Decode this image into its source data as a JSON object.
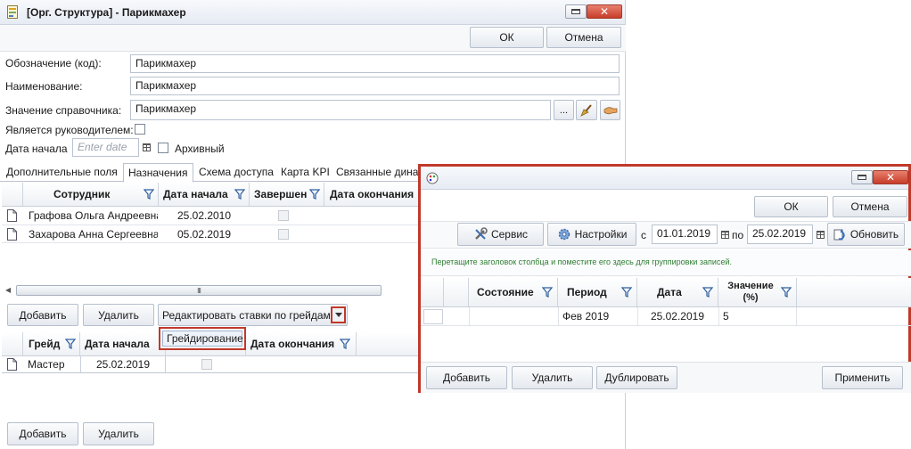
{
  "main": {
    "title": "[Орг. Структура] - Парикмахер",
    "ok": "ОК",
    "cancel": "Отмена",
    "code_label": "Обозначение (код):",
    "code_value": "Парикмахер",
    "name_label": "Наименование:",
    "name_value": "Парикмахер",
    "ref_label": "Значение справочника:",
    "ref_value": "Парикмахер",
    "ellipsis": "...",
    "head_label": "Является руководителем:",
    "start_label": "Дата начала",
    "start_placeholder": "Enter date",
    "archived_label": "Архивный",
    "tabs": [
      "Дополнительные поля",
      "Назначения",
      "Схема доступа",
      "Карта KPI",
      "Связанные дина"
    ],
    "assign_grid": {
      "headers": [
        "Сотрудник",
        "Дата начала",
        "Завершен",
        "Дата окончания"
      ],
      "rows": [
        {
          "employee": "Графова Ольга Андреевна",
          "start": "25.02.2010"
        },
        {
          "employee": "Захарова Анна Сергеевна",
          "start": "05.02.2019"
        }
      ]
    },
    "scroll_grip": "III",
    "add": "Добавить",
    "delete": "Удалить",
    "rates_dropdown": "Редактировать ставки по грейдам",
    "dropdown_item": "Грейдирование",
    "grade_grid": {
      "headers": [
        "Грейд",
        "Дата начала",
        "Дата окончания"
      ],
      "rows": [
        {
          "grade": "Мастер",
          "start": "25.02.2019"
        }
      ]
    },
    "add2": "Добавить",
    "delete2": "Удалить"
  },
  "popup": {
    "ok": "ОК",
    "cancel": "Отмена",
    "service": "Сервис",
    "settings": "Настройки",
    "from_label": "с",
    "from_date": "01.01.2019",
    "to_label": "по",
    "to_date": "25.02.2019",
    "refresh": "Обновить",
    "group_hint": "Перетащите заголовок столбца и поместите его здесь для группировки записей.",
    "headers": [
      "Состояние",
      "Период",
      "Дата",
      "Значение (%)"
    ],
    "rows": [
      {
        "state": "",
        "period": "Фев 2019",
        "date": "25.02.2019",
        "value": "5"
      }
    ],
    "add": "Добавить",
    "delete": "Удалить",
    "duplicate": "Дублировать",
    "apply": "Применить"
  },
  "colors": {
    "highlight_border": "#c0392b",
    "hint_text": "#2e7d32",
    "close_button": "#c63d29"
  }
}
